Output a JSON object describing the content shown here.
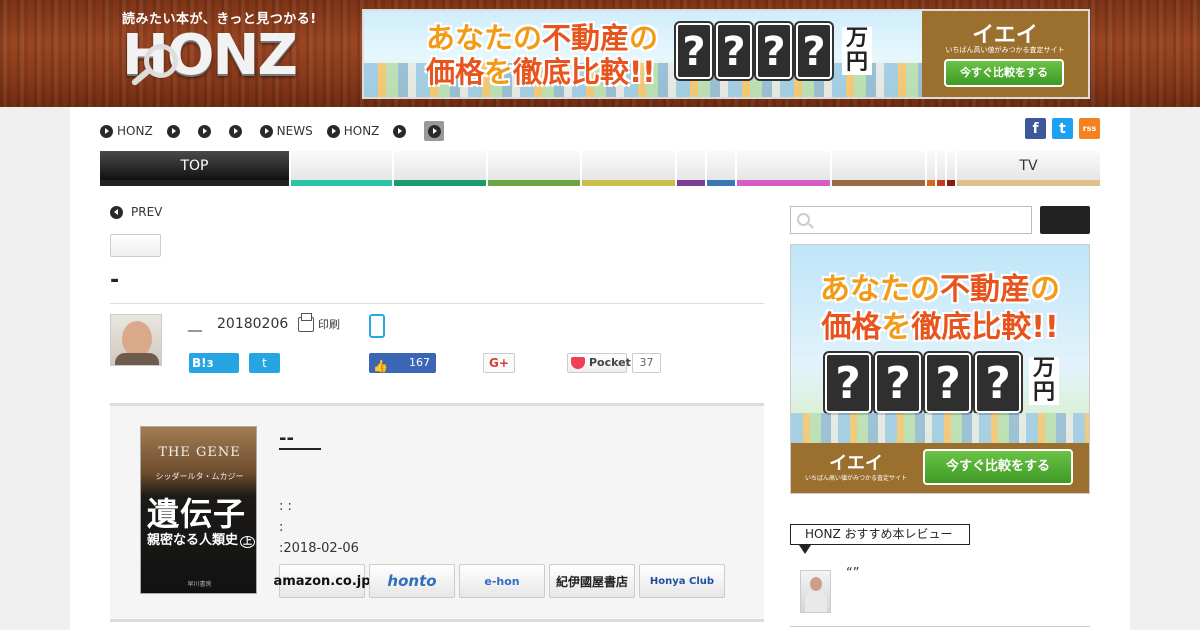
{
  "header": {
    "tagline": "読みたい本が、きっと見つかる!",
    "logo_text": "HONZ"
  },
  "banner_ad": {
    "line1_a": "あなたの",
    "line1_b": "不動産",
    "line1_c": "の",
    "line2_a": "価格",
    "line2_b": "を",
    "line2_c": "徹底比較!!",
    "question_marks": [
      "?",
      "?",
      "?",
      "?"
    ],
    "unit": "万円",
    "brand": "イエイ",
    "brand_sub": "いちばん高い値がみつかる査定サイト",
    "cta": "今すぐ比較をする"
  },
  "topnav": {
    "items": [
      "HONZ",
      "",
      "",
      "",
      "NEWS",
      "HONZ",
      "",
      ""
    ]
  },
  "social_top": {
    "facebook": "f",
    "twitter": "t",
    "rss": "rss"
  },
  "categories": [
    {
      "label": "TOP",
      "color": "#222222"
    },
    {
      "label": "",
      "color": "#2bc3a8"
    },
    {
      "label": "",
      "color": "#1e9a73"
    },
    {
      "label": "",
      "color": "#6aa444"
    },
    {
      "label": "",
      "color": "#c8c04a"
    },
    {
      "label": "",
      "color": "#7a3f93"
    },
    {
      "label": "",
      "color": "#3a78b4"
    },
    {
      "label": "",
      "color": "#d45ec5"
    },
    {
      "label": "",
      "color": "#9a6a40"
    },
    {
      "label": "",
      "color": "#d2691e"
    },
    {
      "label": "",
      "color": "#c23b22"
    },
    {
      "label": "",
      "color": "#8b1a1a"
    },
    {
      "label": "TV",
      "color": "#e0c08a"
    }
  ],
  "article": {
    "prev_label": "PREV",
    "title": "-",
    "author": "__",
    "date": "20180206",
    "print_label": "印刷"
  },
  "share": {
    "hatena_label": "B!",
    "hatena_count": "3",
    "twitter_label": "t",
    "fb_count": "167",
    "gplus_label": "G+",
    "pocket_label": "Pocket",
    "pocket_count": "37"
  },
  "book": {
    "cover_en": "THE GENE",
    "cover_author": "シッダールタ・ムカジー",
    "cover_title": "遺伝子",
    "cover_subtitle": "親密なる人類史",
    "cover_volume": "上",
    "cover_publisher": "早川書房",
    "title": "--",
    "meta_line1": ": :",
    "meta_line2": ":",
    "meta_line3": ":2018-02-06",
    "shops": [
      "amazon.co.jp",
      "honto",
      "e-hon",
      "紀伊國屋書店",
      "Honya Club"
    ]
  },
  "sidebar": {
    "search_placeholder": "",
    "recommend_heading": "HONZ おすすめ本レビュー",
    "recommend_text": "“”"
  }
}
